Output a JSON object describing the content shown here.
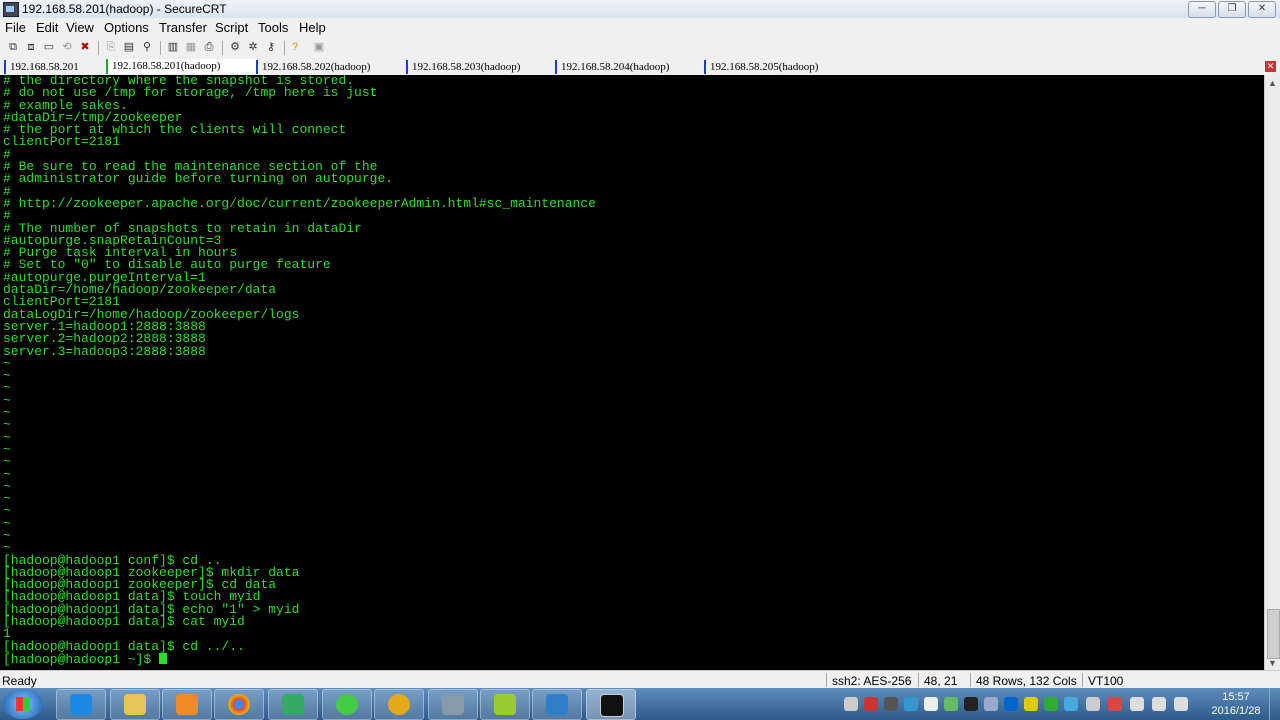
{
  "window": {
    "title": "192.168.58.201(hadoop) - SecureCRT",
    "min": "─",
    "max": "❐",
    "close": "✕"
  },
  "menu": [
    "File",
    "Edit",
    "View",
    "Options",
    "Transfer",
    "Script",
    "Tools",
    "Help"
  ],
  "tabs": [
    "192.168.58.201",
    "192.168.58.201(hadoop)",
    "192.168.58.202(hadoop)",
    "192.168.58.203(hadoop)",
    "192.168.58.204(hadoop)",
    "192.168.58.205(hadoop)"
  ],
  "tab_close": "✕",
  "terminal": {
    "lines": [
      "# the directory where the snapshot is stored.",
      "# do not use /tmp for storage, /tmp here is just",
      "# example sakes.",
      "#dataDir=/tmp/zookeeper",
      "# the port at which the clients will connect",
      "clientPort=2181",
      "#",
      "# Be sure to read the maintenance section of the",
      "# administrator guide before turning on autopurge.",
      "#",
      "# http://zookeeper.apache.org/doc/current/zookeeperAdmin.html#sc_maintenance",
      "#",
      "# The number of snapshots to retain in dataDir",
      "#autopurge.snapRetainCount=3",
      "# Purge task interval in hours",
      "# Set to \"0\" to disable auto purge feature",
      "#autopurge.purgeInterval=1",
      "dataDir=/home/hadoop/zookeeper/data",
      "clientPort=2181",
      "dataLogDir=/home/hadoop/zookeeper/logs",
      "server.1=hadoop1:2888:3888",
      "server.2=hadoop2:2888:3888",
      "server.3=hadoop3:2888:3888",
      "~",
      "~",
      "~",
      "~",
      "~",
      "~",
      "~",
      "~",
      "~",
      "~",
      "~",
      "~",
      "~",
      "~",
      "~",
      "~",
      "[hadoop@hadoop1 conf]$ cd ..",
      "[hadoop@hadoop1 zookeeper]$ mkdir data",
      "[hadoop@hadoop1 zookeeper]$ cd data",
      "[hadoop@hadoop1 data]$ touch myid",
      "[hadoop@hadoop1 data]$ echo \"1\" > myid",
      "[hadoop@hadoop1 data]$ cat myid",
      "1",
      "[hadoop@hadoop1 data]$ cd ../.."
    ],
    "prompt": "[hadoop@hadoop1 ~]$ "
  },
  "status": {
    "ready": "Ready",
    "cipher": "ssh2: AES-256",
    "position": "48,  21",
    "size": "48 Rows, 132 Cols",
    "emulation": "VT100"
  },
  "clock": {
    "time": "15:57",
    "date": "2016/1/28"
  },
  "taskbar_apps": [
    "internet-explorer-icon",
    "file-explorer-icon",
    "media-player-icon",
    "chrome-icon",
    "security-tool-icon",
    "refresh-app-icon",
    "browser-e-icon",
    "remote-app-icon",
    "green-app-icon",
    "virtualbox-icon",
    "securecrt-terminal-icon"
  ]
}
